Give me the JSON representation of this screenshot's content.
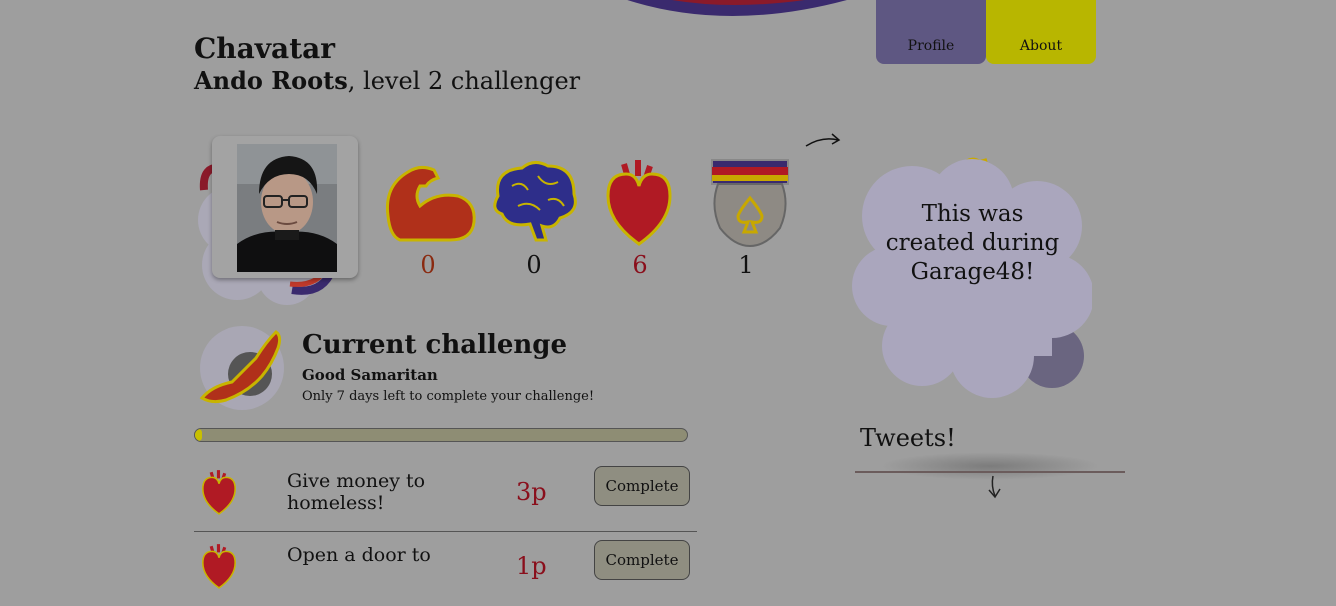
{
  "header": {
    "app_title": "Chavatar",
    "user_name": "Ando Roots",
    "user_level_text": ", level 2 challenger"
  },
  "nav": {
    "tabs": [
      {
        "label": "Profile"
      },
      {
        "label": "About"
      }
    ]
  },
  "stats": [
    {
      "icon": "strength-arm-icon",
      "value": "0",
      "color": "#8a2a10"
    },
    {
      "icon": "brain-icon",
      "value": "0",
      "color": "#111111"
    },
    {
      "icon": "heart-icon",
      "value": "6",
      "color": "#8a0f1c"
    },
    {
      "icon": "spade-medal-icon",
      "value": "1",
      "color": "#111111"
    }
  ],
  "challenge": {
    "heading": "Current challenge",
    "name": "Good Samaritan",
    "deadline_text": "Only 7 days left to complete your challenge!",
    "progress_fraction": 0.01
  },
  "tasks": [
    {
      "icon": "heart-icon",
      "text": "Give money to homeless!",
      "points": "3p",
      "button_label": "Complete"
    },
    {
      "icon": "heart-icon",
      "text": "Open a door to",
      "points": "1p",
      "button_label": "Complete"
    }
  ],
  "sidebar": {
    "info_text": "This was created during Garage48!",
    "tweets_heading": "Tweets!"
  },
  "colors": {
    "background": "#9e9e9e",
    "profile_tab": "#5e5782",
    "about_tab": "#b8b600",
    "points": "#8a0f1c"
  }
}
